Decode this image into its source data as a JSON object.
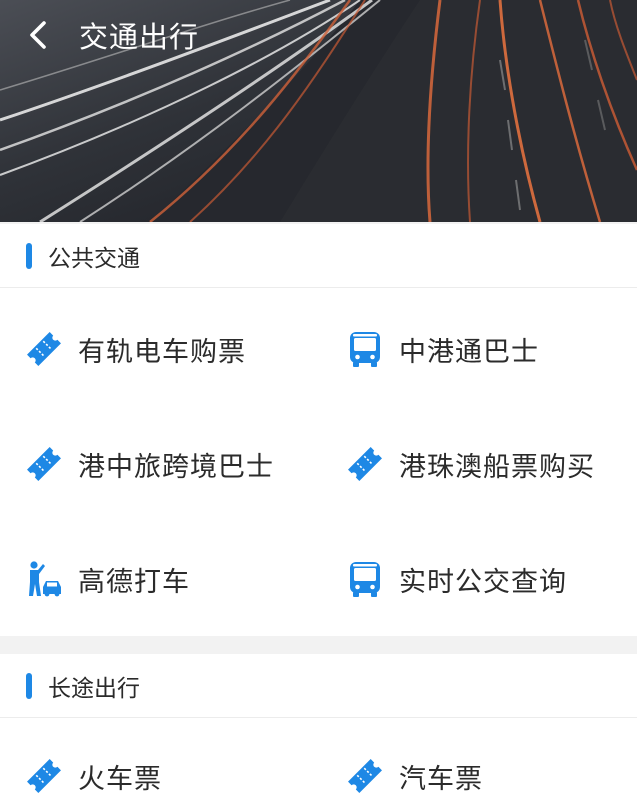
{
  "header": {
    "title": "交通出行"
  },
  "public_transport": {
    "title": "公共交通",
    "items": [
      {
        "label": "有轨电车购票",
        "icon": "ticket-icon"
      },
      {
        "label": "中港通巴士",
        "icon": "bus-icon"
      },
      {
        "label": "港中旅跨境巴士",
        "icon": "ticket-icon"
      },
      {
        "label": "港珠澳船票购买",
        "icon": "ticket-icon"
      },
      {
        "label": "高德打车",
        "icon": "taxi-hail-icon"
      },
      {
        "label": "实时公交查询",
        "icon": "bus-icon"
      }
    ]
  },
  "long_distance": {
    "title": "长途出行",
    "items": [
      {
        "label": "火车票",
        "icon": "ticket-icon"
      },
      {
        "label": "汽车票",
        "icon": "ticket-icon"
      }
    ]
  },
  "colors": {
    "accent": "#1e88e5",
    "text": "#2b2b2b",
    "background": "#f2f2f2"
  }
}
